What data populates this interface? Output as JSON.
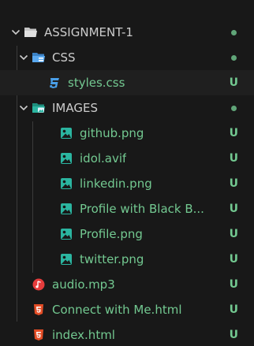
{
  "explorer": {
    "root": {
      "label": "ASSIGNMENT-1",
      "icon": "folder-open-icon"
    },
    "css_folder": {
      "label": "CSS",
      "icon": "css-folder-icon"
    },
    "styles_css": {
      "label": "styles.css",
      "status": "U",
      "icon": "css-file-icon"
    },
    "images_folder": {
      "label": "IMAGES",
      "icon": "images-folder-icon"
    },
    "files": [
      {
        "label": "github.png",
        "status": "U",
        "icon": "image-file-icon"
      },
      {
        "label": "idol.avif",
        "status": "U",
        "icon": "image-file-icon"
      },
      {
        "label": "linkedin.png",
        "status": "U",
        "icon": "image-file-icon"
      },
      {
        "label": "Profile with Black B...",
        "status": "U",
        "icon": "image-file-icon"
      },
      {
        "label": "Profile.png",
        "status": "U",
        "icon": "image-file-icon"
      },
      {
        "label": "twitter.png",
        "status": "U",
        "icon": "image-file-icon"
      }
    ],
    "root_files": [
      {
        "label": "audio.mp3",
        "status": "U",
        "icon": "audio-file-icon"
      },
      {
        "label": "Connect with Me.html",
        "status": "U",
        "icon": "html-file-icon"
      },
      {
        "label": "index.html",
        "status": "U",
        "icon": "html-file-icon"
      }
    ]
  },
  "colors": {
    "background": "#181818",
    "untracked_green": "#73c991",
    "css_blue": "#4a9fe8",
    "image_teal": "#2bb5a0",
    "html_orange": "#e44d26",
    "audio_red": "#e63c3c"
  }
}
